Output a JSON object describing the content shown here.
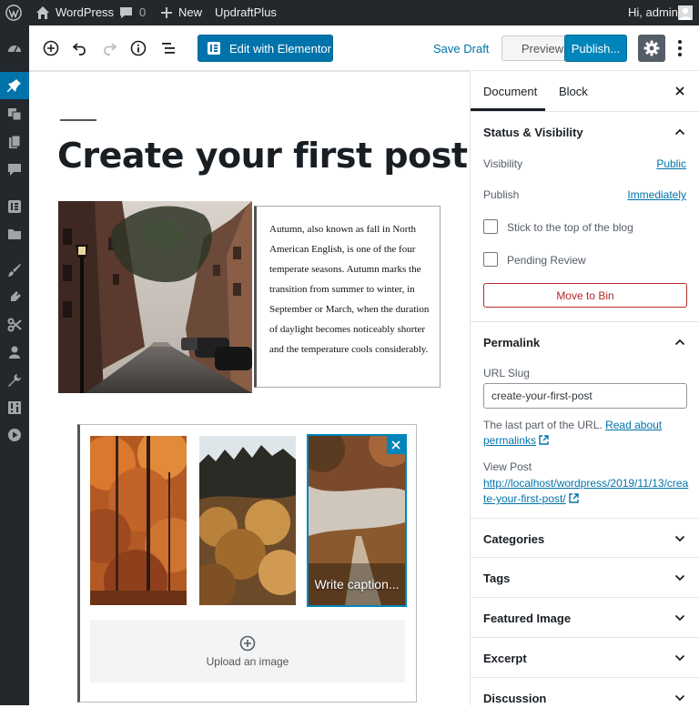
{
  "adminbar": {
    "site_name": "WordPress",
    "comments_count": "0",
    "new_label": "New",
    "plugin_label": "UpdraftPlus",
    "greeting": "Hi, admin"
  },
  "toolbar": {
    "elementor_label": "Edit with Elementor",
    "save_draft_label": "Save Draft",
    "preview_label": "Preview",
    "publish_label": "Publish..."
  },
  "post": {
    "title": "Create your first post",
    "paragraph": "Autumn, also known as fall in North American English, is one of the four temperate seasons. Autumn marks the transition from summer to winter, in September or March, when the duration of daylight becomes noticeably shorter and the temperature cools considerably.",
    "caption_placeholder": "Write caption...",
    "upload_label": "Upload an image"
  },
  "sidebar": {
    "tabs": [
      {
        "label": "Document"
      },
      {
        "label": "Block"
      }
    ],
    "status": {
      "title": "Status & Visibility",
      "visibility_label": "Visibility",
      "visibility_value": "Public",
      "publish_label": "Publish",
      "publish_value": "Immediately",
      "sticky_label": "Stick to the top of the blog",
      "pending_label": "Pending Review",
      "bin_label": "Move to Bin"
    },
    "permalink": {
      "title": "Permalink",
      "slug_label": "URL Slug",
      "slug_value": "create-your-first-post",
      "help_text": "The last part of the URL.",
      "help_link": "Read about permalinks",
      "view_label": "View Post",
      "view_url": "http://localhost/wordpress/2019/11/13/create-your-first-post/"
    },
    "panels": [
      {
        "title": "Categories"
      },
      {
        "title": "Tags"
      },
      {
        "title": "Featured Image"
      },
      {
        "title": "Excerpt"
      },
      {
        "title": "Discussion"
      }
    ]
  },
  "colors": {
    "admin_dark": "#23282d",
    "accent": "#0073aa",
    "publish": "#0085ba",
    "danger": "#b52727"
  },
  "icons": {
    "adminbar": [
      "wordpress-logo-icon",
      "home-icon",
      "comment-icon",
      "plus-icon",
      "avatar-icon"
    ],
    "toolbar": [
      "add-block-icon",
      "undo-icon",
      "redo-icon",
      "info-icon",
      "outline-icon",
      "elementor-icon",
      "gear-icon",
      "more-vertical-icon"
    ]
  }
}
